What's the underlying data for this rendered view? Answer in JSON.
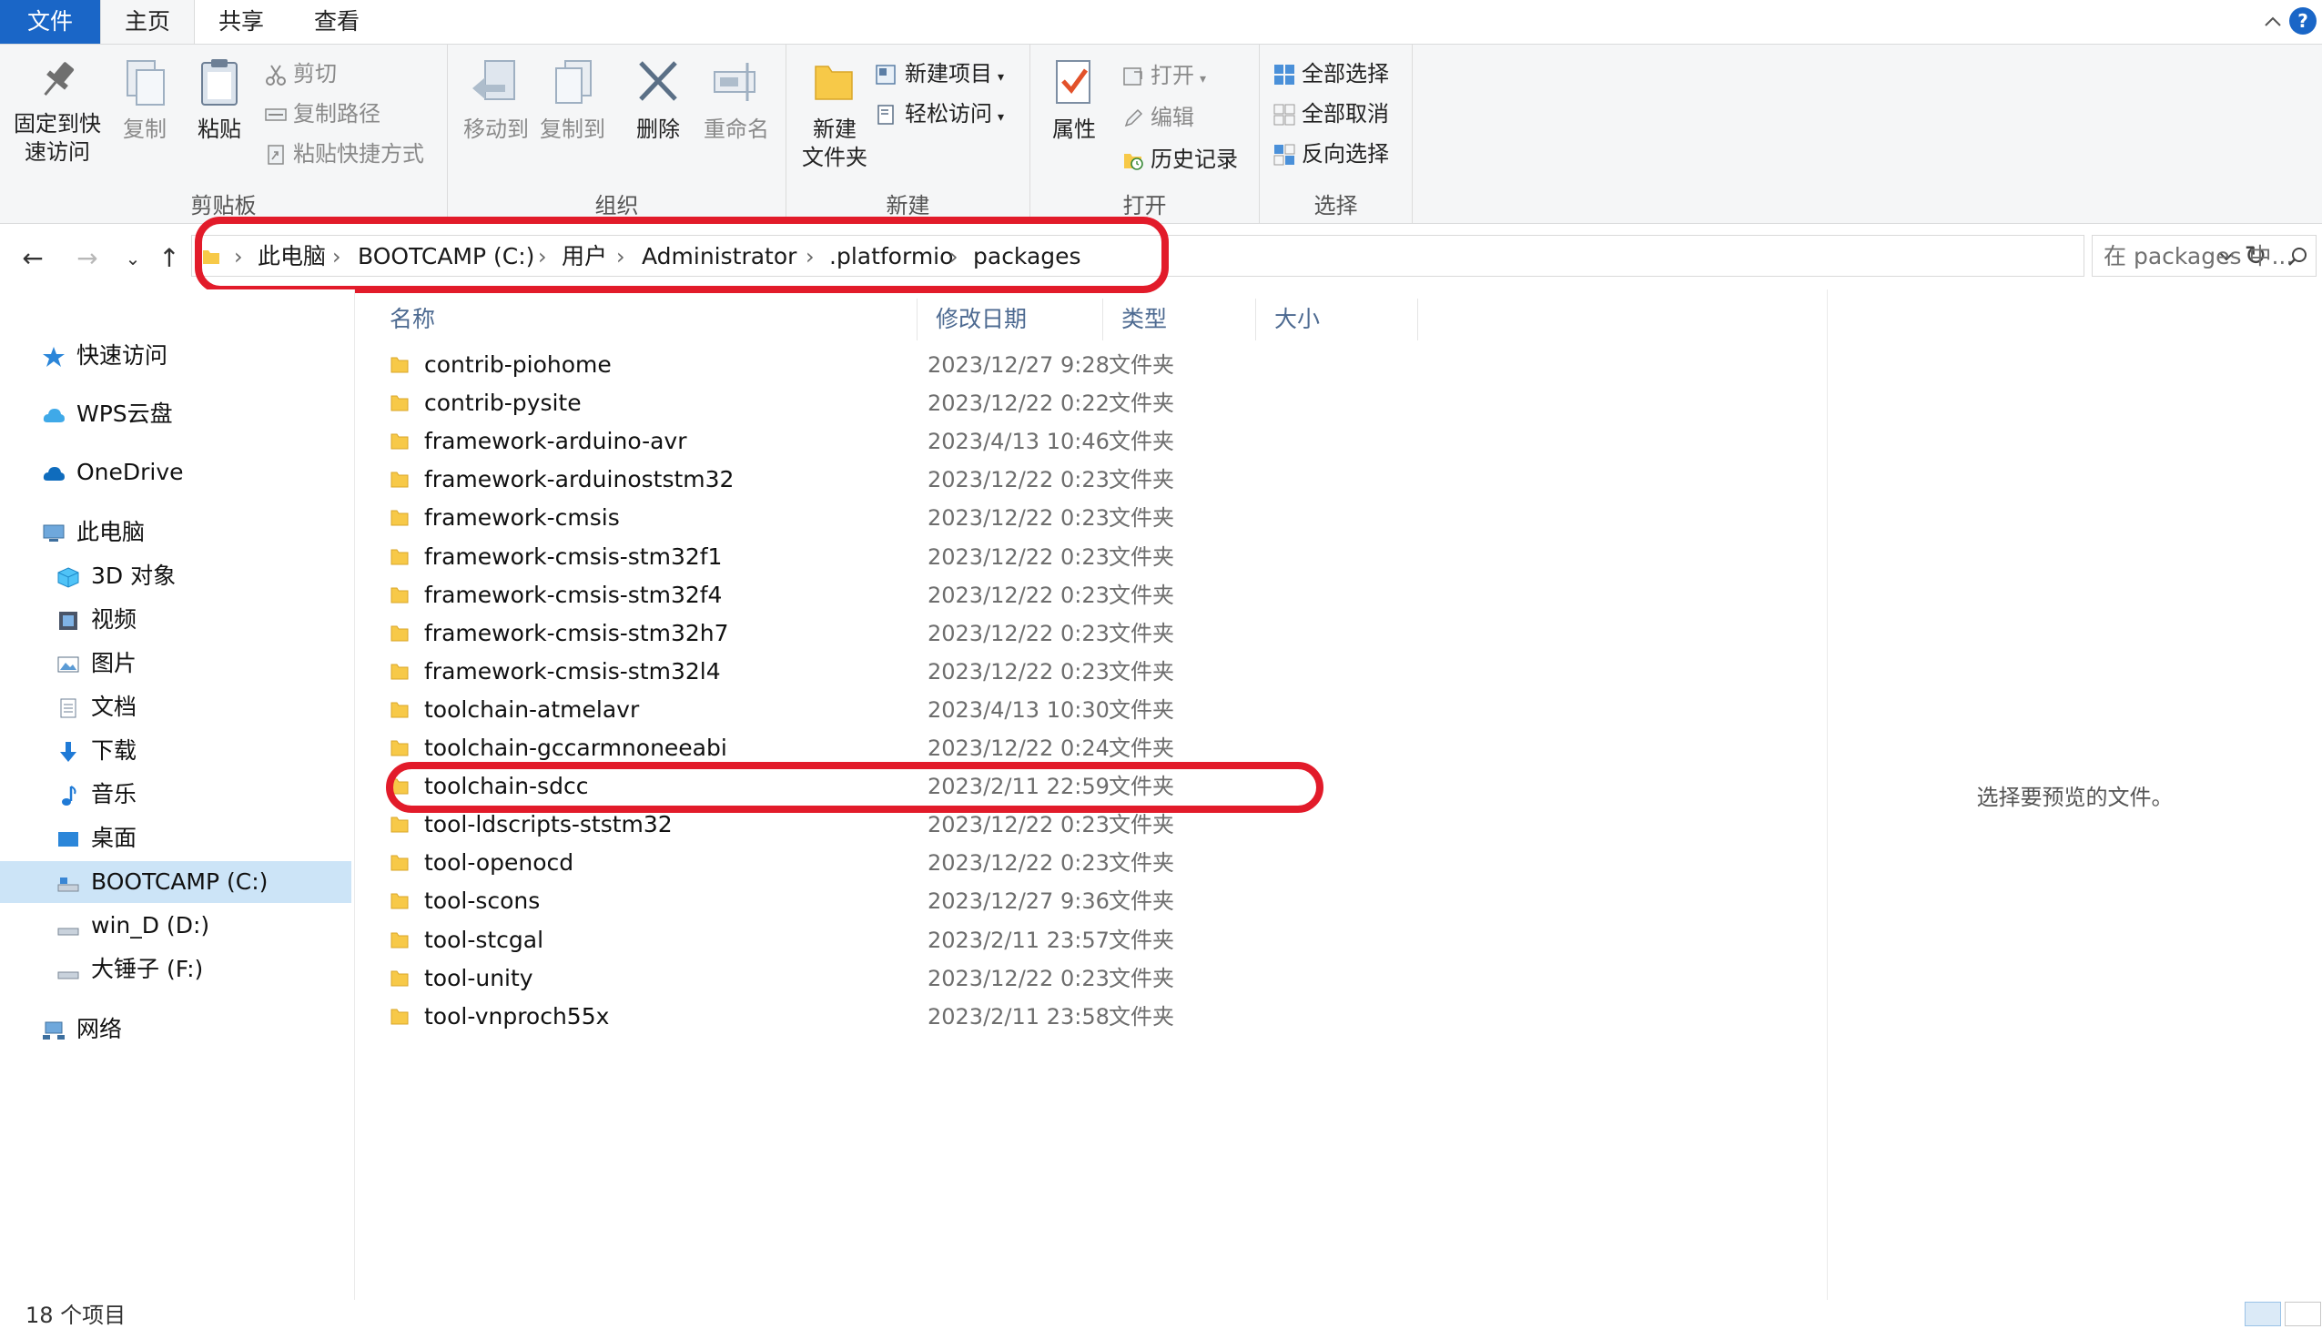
{
  "ribbon_tabs": [
    "文件",
    "主页",
    "共享",
    "查看"
  ],
  "help": "?",
  "clipboard": {
    "pin_label_1": "固定到快",
    "pin_label_2": "速访问",
    "copy": "复制",
    "paste": "粘贴",
    "cut": "剪切",
    "copy_path": "复制路径",
    "paste_shortcut": "粘贴快捷方式",
    "group": "剪贴板"
  },
  "organize": {
    "move_to": "移动到",
    "copy_to": "复制到",
    "delete": "删除",
    "rename": "重命名",
    "group": "组织"
  },
  "new": {
    "new_folder_1": "新建",
    "new_folder_2": "文件夹",
    "new_item": "新建项目",
    "easy_access": "轻松访问",
    "group": "新建"
  },
  "open": {
    "properties": "属性",
    "open": "打开",
    "edit": "编辑",
    "history": "历史记录",
    "group": "打开"
  },
  "select": {
    "select_all": "全部选择",
    "select_none": "全部取消",
    "invert": "反向选择",
    "group": "选择"
  },
  "address": {
    "crumbs": [
      "此电脑",
      "BOOTCAMP (C:)",
      "用户",
      "Administrator",
      ".platformio",
      "packages"
    ]
  },
  "search": {
    "placeholder": "在 packages 中..."
  },
  "nav": {
    "quick_access": "快速访问",
    "wps": "WPS云盘",
    "onedrive": "OneDrive",
    "this_pc": "此电脑",
    "objects3d": "3D 对象",
    "videos": "视频",
    "pictures": "图片",
    "documents": "文档",
    "downloads": "下载",
    "music": "音乐",
    "desktop": "桌面",
    "drive_c": "BOOTCAMP (C:)",
    "drive_d": "win_D (D:)",
    "drive_f": "大锤子 (F:)",
    "network": "网络"
  },
  "columns": {
    "name": "名称",
    "modified": "修改日期",
    "type": "类型",
    "size": "大小"
  },
  "files": [
    {
      "name": "contrib-piohome",
      "date": "2023/12/27 9:28",
      "type": "文件夹"
    },
    {
      "name": "contrib-pysite",
      "date": "2023/12/22 0:22",
      "type": "文件夹"
    },
    {
      "name": "framework-arduino-avr",
      "date": "2023/4/13 10:46",
      "type": "文件夹"
    },
    {
      "name": "framework-arduinoststm32",
      "date": "2023/12/22 0:23",
      "type": "文件夹"
    },
    {
      "name": "framework-cmsis",
      "date": "2023/12/22 0:23",
      "type": "文件夹"
    },
    {
      "name": "framework-cmsis-stm32f1",
      "date": "2023/12/22 0:23",
      "type": "文件夹"
    },
    {
      "name": "framework-cmsis-stm32f4",
      "date": "2023/12/22 0:23",
      "type": "文件夹"
    },
    {
      "name": "framework-cmsis-stm32h7",
      "date": "2023/12/22 0:23",
      "type": "文件夹"
    },
    {
      "name": "framework-cmsis-stm32l4",
      "date": "2023/12/22 0:23",
      "type": "文件夹"
    },
    {
      "name": "toolchain-atmelavr",
      "date": "2023/4/13 10:30",
      "type": "文件夹"
    },
    {
      "name": "toolchain-gccarmnoneeabi",
      "date": "2023/12/22 0:24",
      "type": "文件夹"
    },
    {
      "name": "toolchain-sdcc",
      "date": "2023/2/11 22:59",
      "type": "文件夹"
    },
    {
      "name": "tool-ldscripts-ststm32",
      "date": "2023/12/22 0:23",
      "type": "文件夹"
    },
    {
      "name": "tool-openocd",
      "date": "2023/12/22 0:23",
      "type": "文件夹"
    },
    {
      "name": "tool-scons",
      "date": "2023/12/27 9:36",
      "type": "文件夹"
    },
    {
      "name": "tool-stcgal",
      "date": "2023/2/11 23:57",
      "type": "文件夹"
    },
    {
      "name": "tool-unity",
      "date": "2023/12/22 0:23",
      "type": "文件夹"
    },
    {
      "name": "tool-vnproch55x",
      "date": "2023/2/11 23:58",
      "type": "文件夹"
    }
  ],
  "preview": {
    "message": "选择要预览的文件。"
  },
  "status": {
    "count": "18 个项目"
  },
  "colors": {
    "accent": "#1a66c7",
    "selection": "#cce4f7",
    "annotation": "#e21b2a"
  }
}
